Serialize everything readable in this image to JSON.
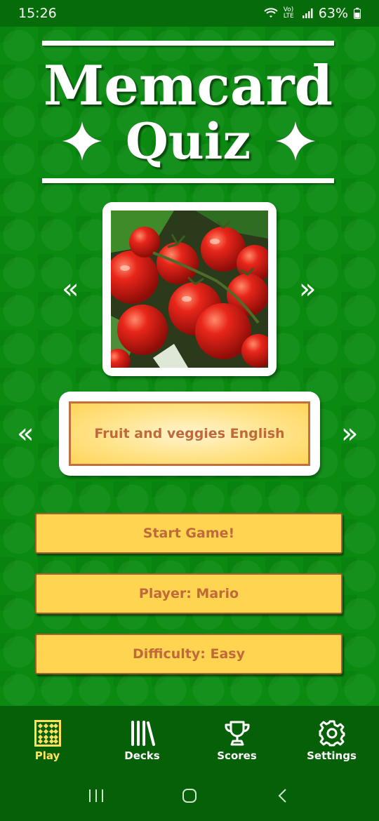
{
  "status_bar": {
    "time": "15:26",
    "network_label": "Vo) LTE",
    "battery": "63%"
  },
  "title": {
    "line1": "Memcard",
    "line2": "Quiz"
  },
  "image_carousel": {
    "prev": "«",
    "next": "»",
    "image_icon": "tomatoes-photo"
  },
  "deck_carousel": {
    "prev": "«",
    "next": "»",
    "deck_name": "Fruit and veggies English"
  },
  "menu": {
    "start": "Start Game!",
    "player": "Player: Mario",
    "difficulty": "Difficulty: Easy"
  },
  "bottom_nav": {
    "items": [
      {
        "label": "Play",
        "icon": "grid-icon",
        "active": true
      },
      {
        "label": "Decks",
        "icon": "library-icon",
        "active": false
      },
      {
        "label": "Scores",
        "icon": "trophy-icon",
        "active": false
      },
      {
        "label": "Settings",
        "icon": "gear-icon",
        "active": false
      }
    ]
  },
  "colors": {
    "background_green": "#0a8a10",
    "button_yellow": "#ffd451",
    "button_text": "#c06a3a",
    "active_nav": "#ffe15a"
  }
}
